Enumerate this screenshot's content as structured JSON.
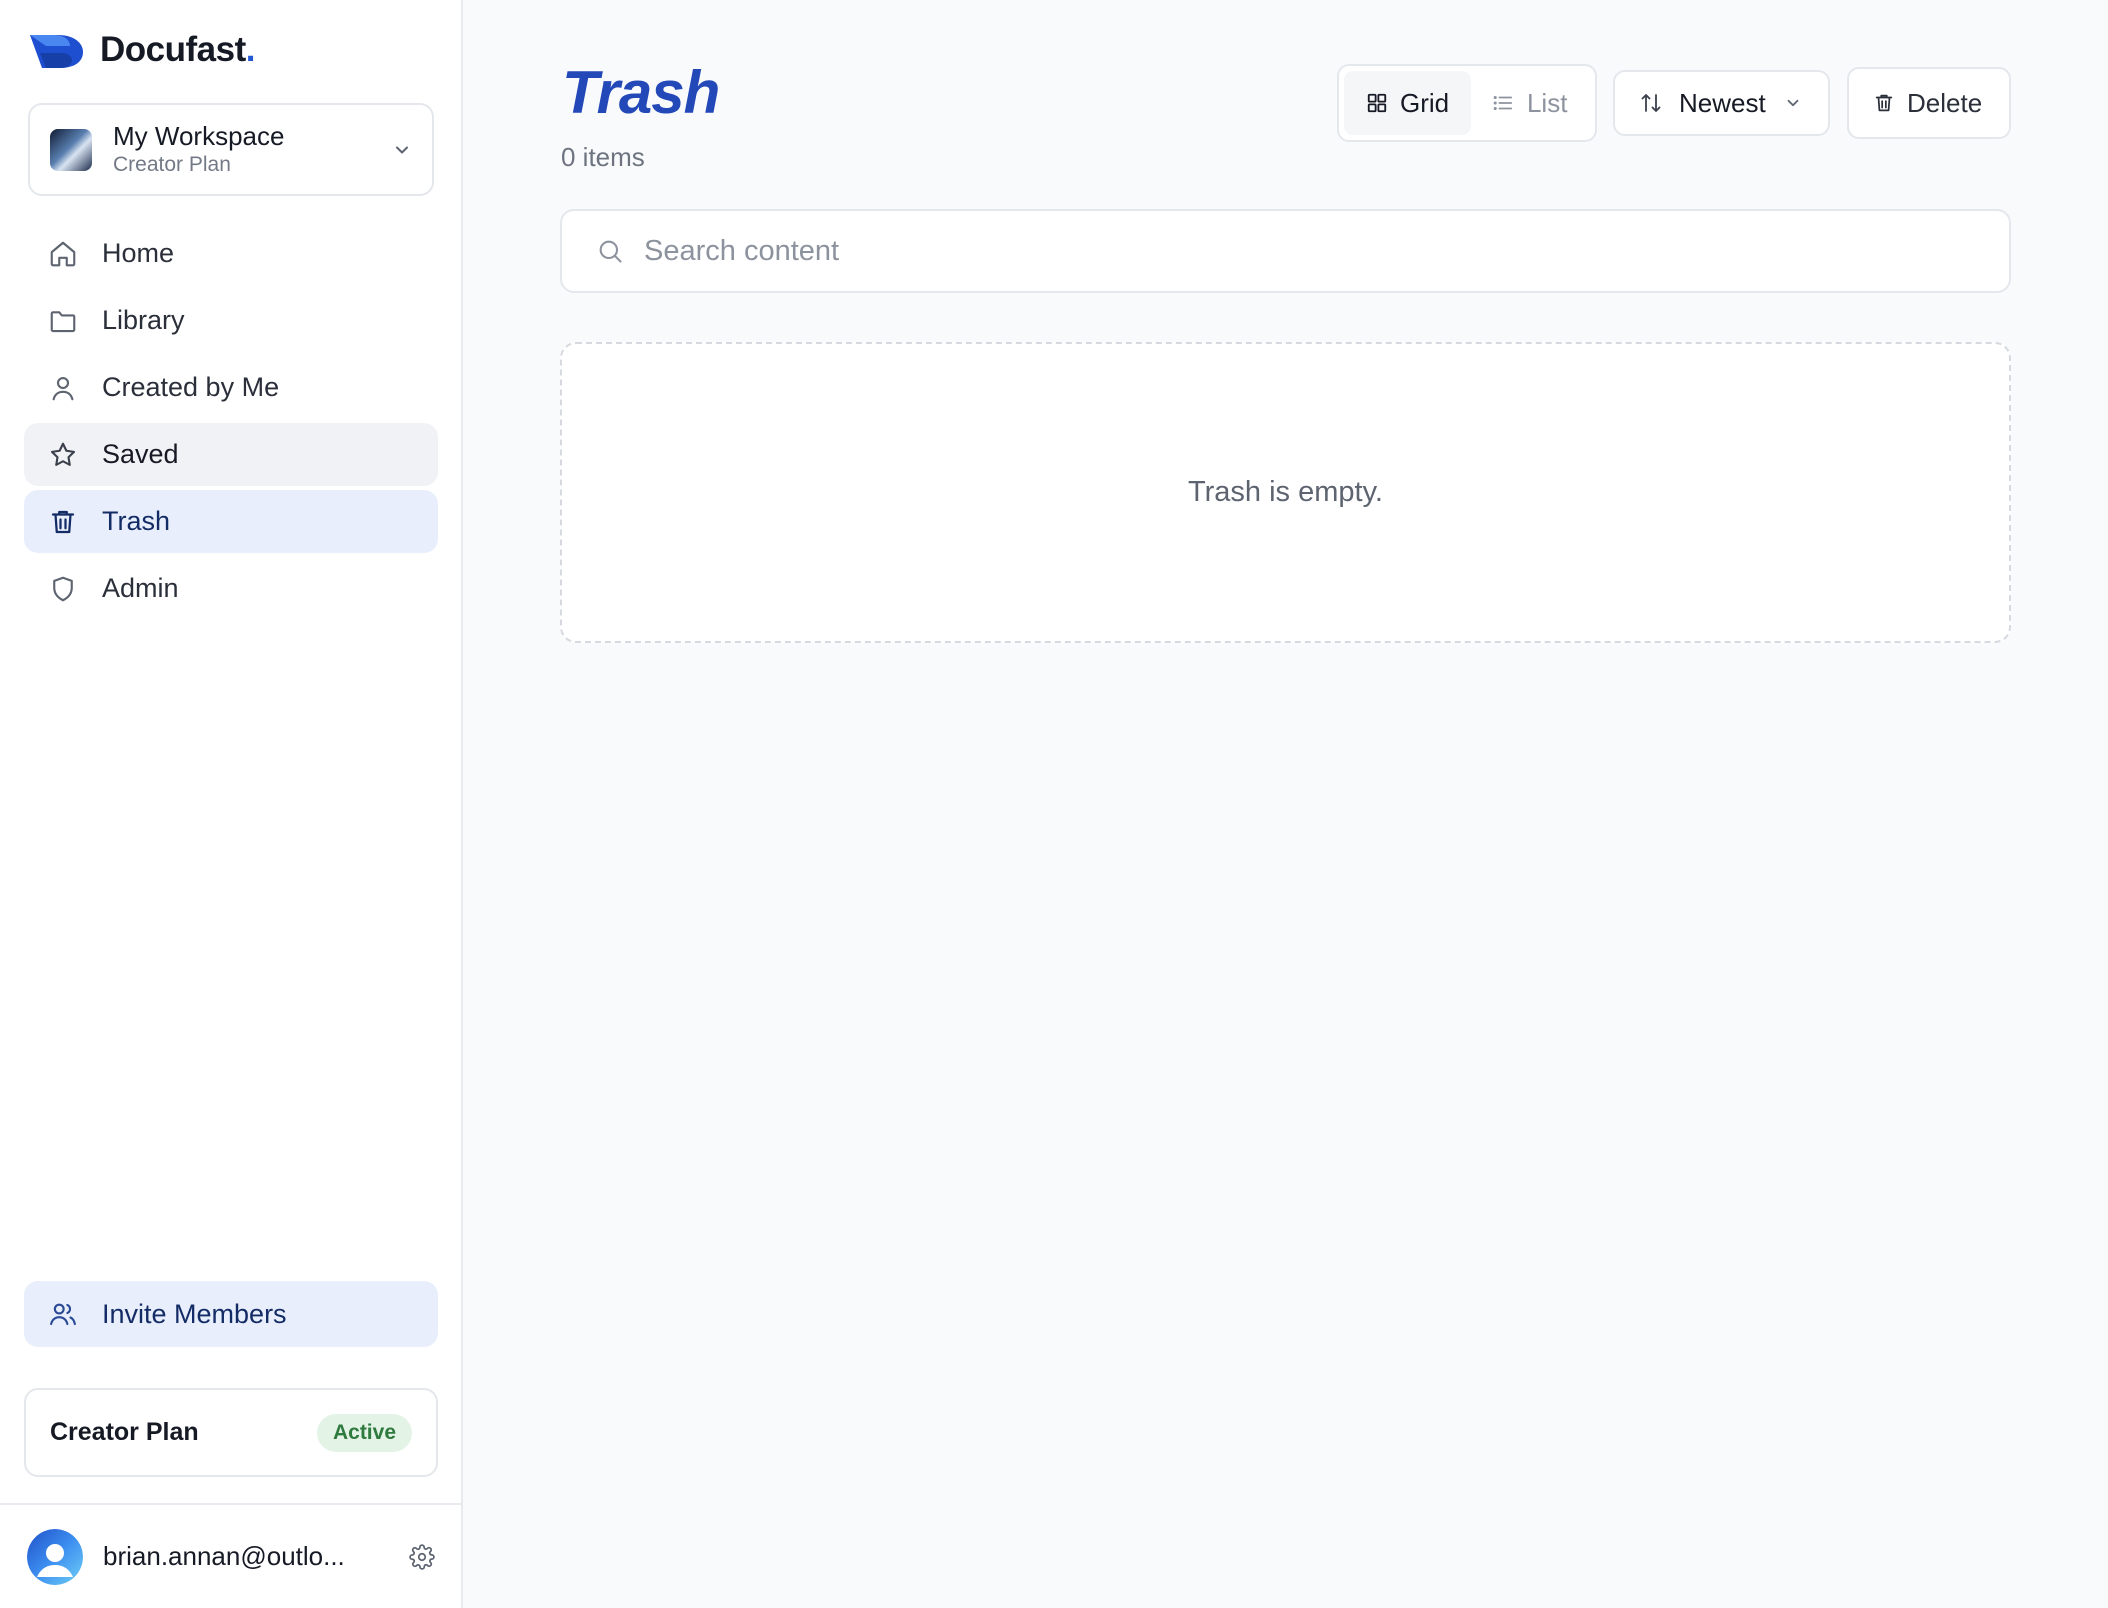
{
  "brand": {
    "name": "Docufast",
    "dot": "."
  },
  "workspace": {
    "name": "My Workspace",
    "plan": "Creator Plan"
  },
  "nav": {
    "items": [
      {
        "label": "Home",
        "icon": "home-icon"
      },
      {
        "label": "Library",
        "icon": "folder-icon"
      },
      {
        "label": "Created by Me",
        "icon": "user-icon"
      },
      {
        "label": "Saved",
        "icon": "star-icon"
      },
      {
        "label": "Trash",
        "icon": "trash-icon",
        "active": true
      },
      {
        "label": "Admin",
        "icon": "shield-icon"
      }
    ]
  },
  "invite": {
    "label": "Invite Members",
    "icon": "users-icon"
  },
  "plan_card": {
    "name": "Creator Plan",
    "status": "Active"
  },
  "user": {
    "email": "brian.annan@outlo..."
  },
  "page": {
    "title": "Trash",
    "count": "0 items"
  },
  "toolbar": {
    "view_grid": "Grid",
    "view_list": "List",
    "selected_view": "Grid",
    "sort_label": "Newest",
    "delete_label": "Delete"
  },
  "search": {
    "placeholder": "Search content",
    "value": ""
  },
  "empty_state": {
    "message": "Trash is empty."
  },
  "colors": {
    "accent": "#2457d6",
    "title": "#2348b8",
    "active_nav_bg": "#e8eefb",
    "active_badge_bg": "#e3f3e6",
    "active_badge_text": "#2f7a3e"
  }
}
